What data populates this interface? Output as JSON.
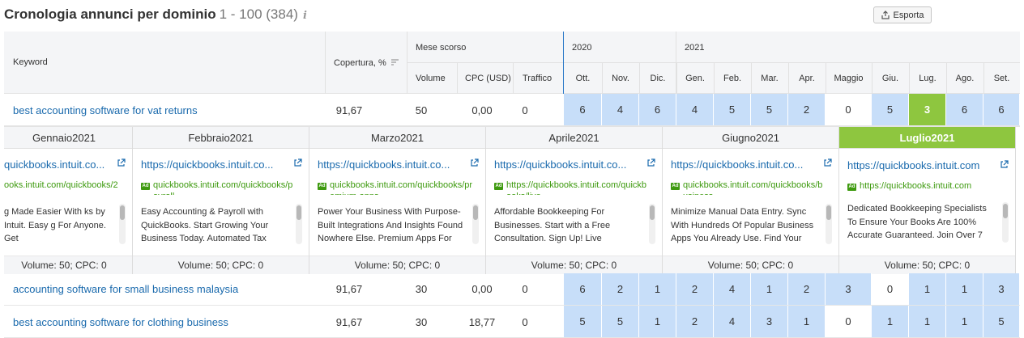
{
  "header": {
    "title": "Cronologia annunci per dominio",
    "count": "1 - 100 (384)",
    "info_icon": "i",
    "export_label": "Esporta"
  },
  "columns": {
    "keyword": "Keyword",
    "coverage": "Copertura, %",
    "last_month": "Mese scorso",
    "volume": "Volume",
    "cpc": "CPC (USD)",
    "traffic": "Traffico",
    "year1": "2020",
    "year2": "2021",
    "months": [
      "Ott.",
      "Nov.",
      "Dic.",
      "Gen.",
      "Feb.",
      "Mar.",
      "Apr.",
      "Maggio",
      "Giu.",
      "Lug.",
      "Ago.",
      "Set."
    ]
  },
  "rows": [
    {
      "keyword": "best accounting software for vat returns",
      "coverage": "91,67",
      "volume": "50",
      "cpc": "0,00",
      "traffic": "0",
      "positions": [
        "6",
        "4",
        "6",
        "4",
        "5",
        "5",
        "2",
        "0",
        "5",
        "3",
        "6",
        "6"
      ]
    },
    {
      "keyword": "accounting software for small business malaysia",
      "coverage": "91,67",
      "volume": "30",
      "cpc": "0,00",
      "traffic": "0",
      "positions": [
        "6",
        "2",
        "1",
        "2",
        "4",
        "1",
        "2",
        "3",
        "0",
        "1",
        "1",
        "3"
      ]
    },
    {
      "keyword": "best accounting software for clothing business",
      "coverage": "91,67",
      "volume": "30",
      "cpc": "18,77",
      "traffic": "0",
      "positions": [
        "5",
        "5",
        "1",
        "2",
        "4",
        "3",
        "1",
        "0",
        "1",
        "1",
        "1",
        "5"
      ]
    }
  ],
  "ads": [
    {
      "month": "Gennaio2021",
      "url": "quickbooks.intuit.co...",
      "display": "ooks.intuit.com/quickbooks/2",
      "desc": "g Made Easier With ks by Intuit. Easy g For Anyone. Get",
      "footer": "Volume: 50;  CPC: 0"
    },
    {
      "month": "Febbraio2021",
      "url": "https://quickbooks.intuit.co...",
      "display": "quickbooks.intuit.com/quickbooks/p",
      "display_tail": "ayroll",
      "desc": "Easy Accounting & Payroll with QuickBooks. Start Growing Your Business Today. Automated Tax",
      "footer": "Volume: 50;  CPC: 0"
    },
    {
      "month": "Marzo2021",
      "url": "https://quickbooks.intuit.co...",
      "display": "quickbooks.intuit.com/quickbooks/pr",
      "display_tail": "emium-apps",
      "desc": "Power Your Business With Purpose-Built Integrations And Insights Found Nowhere Else. Premium Apps For",
      "footer": "Volume: 50;  CPC: 0"
    },
    {
      "month": "Aprile2021",
      "url": "https://quickbooks.intuit.co...",
      "display": "https://quickbooks.intuit.com/quickb",
      "display_tail": "ooks/live",
      "desc": "Affordable Bookkeeping For Businesses. Start with a Free Consultation. Sign Up! Live",
      "footer": "Volume: 50;  CPC: 0"
    },
    {
      "month": "Giugno2021",
      "url": "https://quickbooks.intuit.co...",
      "display": "quickbooks.intuit.com/quickbooks/b",
      "display_tail": "usiness",
      "desc": "Minimize Manual Data Entry. Sync With Hundreds Of Popular Business Apps You Already Use. Find Your",
      "footer": "Volume: 50;  CPC: 0"
    },
    {
      "month": "Luglio2021",
      "url": "https://quickbooks.intuit.com",
      "display": "https://quickbooks.intuit.com",
      "desc": "Dedicated Bookkeeping Specialists To Ensure Your Books Are 100% Accurate Guaranteed. Join Over 7",
      "footer": "Volume: 50;  CPC: 0"
    }
  ],
  "colors": {
    "link": "#1a6aad",
    "display_url": "#3e9a0f",
    "cell_blue": "#c7def9",
    "cell_green": "#8ec63f"
  }
}
